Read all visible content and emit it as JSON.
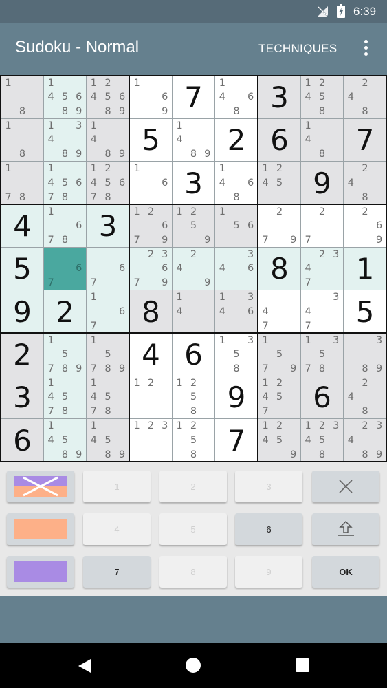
{
  "status_bar": {
    "time": "6:39",
    "icons": [
      "no-sim-icon",
      "battery-charging-icon"
    ]
  },
  "app_bar": {
    "title": "Sudoku - Normal",
    "action_label": "TECHNIQUES",
    "overflow_icon": "more-vert-icon"
  },
  "board": {
    "rows": [
      [
        {
          "c": [
            1,
            8
          ]
        },
        {
          "c": [
            1,
            4,
            5,
            6,
            8,
            9
          ]
        },
        {
          "c": [
            1,
            2,
            4,
            5,
            6,
            8,
            9
          ]
        },
        {
          "c": [
            1,
            6,
            9
          ]
        },
        {
          "v": 7
        },
        {
          "c": [
            1,
            4,
            6,
            8
          ]
        },
        {
          "v": 3
        },
        {
          "c": [
            1,
            2,
            4,
            5,
            8
          ]
        },
        {
          "c": [
            2,
            4,
            8
          ]
        }
      ],
      [
        {
          "c": [
            1,
            8
          ]
        },
        {
          "c": [
            1,
            3,
            4,
            8,
            9
          ]
        },
        {
          "c": [
            1,
            4,
            8,
            9
          ]
        },
        {
          "v": 5
        },
        {
          "c": [
            1,
            4,
            8,
            9
          ]
        },
        {
          "v": 2
        },
        {
          "v": 6
        },
        {
          "c": [
            1,
            4,
            8
          ]
        },
        {
          "v": 7
        }
      ],
      [
        {
          "c": [
            1,
            7,
            8
          ]
        },
        {
          "c": [
            1,
            4,
            5,
            6,
            7,
            8
          ]
        },
        {
          "c": [
            1,
            2,
            4,
            5,
            6,
            7,
            8
          ]
        },
        {
          "c": [
            1,
            6
          ]
        },
        {
          "v": 3
        },
        {
          "c": [
            1,
            4,
            6,
            8
          ]
        },
        {
          "c": [
            1,
            2,
            4,
            5
          ]
        },
        {
          "v": 9
        },
        {
          "c": [
            2,
            4,
            8
          ]
        }
      ],
      [
        {
          "v": 4
        },
        {
          "c": [
            1,
            6,
            7,
            8
          ]
        },
        {
          "v": 3
        },
        {
          "c": [
            1,
            2,
            6,
            7,
            9
          ]
        },
        {
          "c": [
            1,
            2,
            5,
            9
          ]
        },
        {
          "c": [
            1,
            5,
            6
          ]
        },
        {
          "c": [
            2,
            7,
            9
          ]
        },
        {
          "c": [
            2,
            7
          ]
        },
        {
          "c": [
            2,
            6,
            9
          ]
        }
      ],
      [
        {
          "v": 5
        },
        {
          "c": [
            6,
            7
          ]
        },
        {
          "c": [
            6,
            7
          ]
        },
        {
          "c": [
            2,
            3,
            6,
            7,
            9
          ]
        },
        {
          "c": [
            2,
            4,
            9
          ]
        },
        {
          "c": [
            3,
            4,
            6
          ]
        },
        {
          "v": 8
        },
        {
          "c": [
            2,
            3,
            4,
            7
          ]
        },
        {
          "v": 1
        }
      ],
      [
        {
          "v": 9
        },
        {
          "v": 2
        },
        {
          "c": [
            1,
            6,
            7
          ]
        },
        {
          "v": 8
        },
        {
          "c": [
            1,
            4
          ]
        },
        {
          "c": [
            1,
            3,
            4,
            6
          ]
        },
        {
          "c": [
            4,
            7
          ]
        },
        {
          "c": [
            3,
            4,
            7
          ]
        },
        {
          "v": 5
        }
      ],
      [
        {
          "v": 2
        },
        {
          "c": [
            1,
            5,
            7,
            8,
            9
          ]
        },
        {
          "c": [
            1,
            5,
            7,
            8,
            9
          ]
        },
        {
          "v": 4
        },
        {
          "v": 6
        },
        {
          "c": [
            1,
            3,
            5,
            8
          ]
        },
        {
          "c": [
            1,
            5,
            7,
            9
          ]
        },
        {
          "c": [
            1,
            3,
            5,
            7,
            8
          ]
        },
        {
          "c": [
            3,
            8,
            9
          ]
        }
      ],
      [
        {
          "v": 3
        },
        {
          "c": [
            1,
            4,
            5,
            7,
            8
          ]
        },
        {
          "c": [
            1,
            4,
            5,
            7,
            8
          ]
        },
        {
          "c": [
            1,
            2
          ]
        },
        {
          "c": [
            1,
            2,
            5,
            8
          ]
        },
        {
          "v": 9
        },
        {
          "c": [
            1,
            2,
            4,
            5,
            7
          ]
        },
        {
          "v": 6
        },
        {
          "c": [
            2,
            4,
            8
          ]
        }
      ],
      [
        {
          "v": 6
        },
        {
          "c": [
            1,
            4,
            5,
            8,
            9
          ]
        },
        {
          "c": [
            1,
            4,
            5,
            8,
            9
          ]
        },
        {
          "c": [
            1,
            2,
            3
          ]
        },
        {
          "c": [
            1,
            2,
            5,
            8
          ]
        },
        {
          "v": 7
        },
        {
          "c": [
            1,
            2,
            4,
            5,
            9
          ]
        },
        {
          "c": [
            1,
            2,
            3,
            4,
            5,
            8
          ]
        },
        {
          "c": [
            2,
            3,
            4,
            8,
            9
          ]
        }
      ]
    ],
    "selected_cell": {
      "row": 4,
      "col": 1
    },
    "colors": {
      "given_shaded": "#e3e3e5",
      "white": "#ffffff",
      "highlight": "#e3f2f0",
      "selected": "#4aa89f",
      "thin_line": "#9aa3a7",
      "thick_line": "#111111"
    }
  },
  "keypad": {
    "number_keys": [
      {
        "label": "1",
        "enabled": false
      },
      {
        "label": "2",
        "enabled": false
      },
      {
        "label": "3",
        "enabled": false
      },
      {
        "label": "4",
        "enabled": false
      },
      {
        "label": "5",
        "enabled": false
      },
      {
        "label": "6",
        "enabled": true
      },
      {
        "label": "7",
        "enabled": true
      },
      {
        "label": "8",
        "enabled": false
      },
      {
        "label": "9",
        "enabled": false
      }
    ],
    "clear_icon": "close-x-icon",
    "undo_icon": "undo-arrow-icon",
    "ok_label": "OK",
    "color_swatches": [
      {
        "name": "cross-color-swatch",
        "colors": [
          "#a98be4",
          "#fdb088"
        ]
      },
      {
        "name": "orange-swatch",
        "color": "#fdb088"
      },
      {
        "name": "purple-swatch",
        "color": "#a98be4"
      }
    ]
  },
  "nav_bar": {
    "icons": [
      "back-icon",
      "home-icon",
      "recents-icon"
    ]
  }
}
